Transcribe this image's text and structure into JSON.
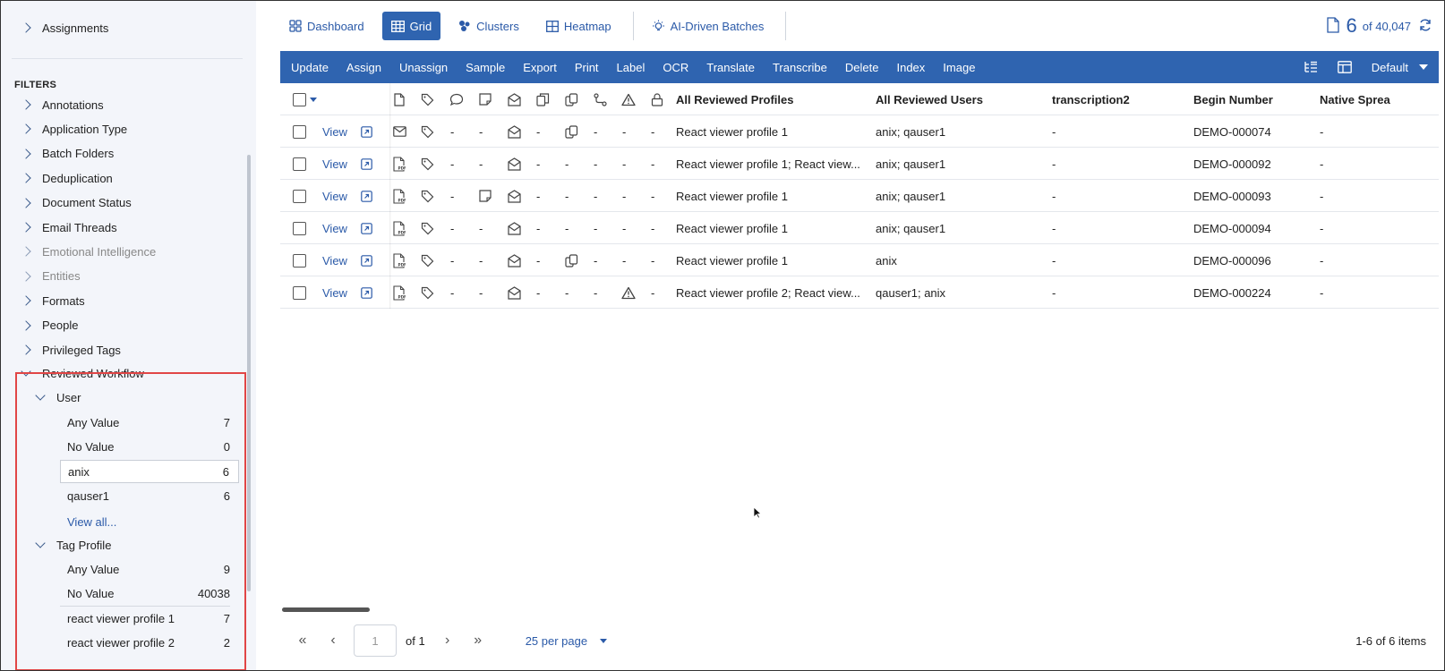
{
  "sidebar": {
    "assignments": "Assignments",
    "filters_title": "FILTERS",
    "filters": [
      {
        "label": "Annotations",
        "muted": false
      },
      {
        "label": "Application Type",
        "muted": false
      },
      {
        "label": "Batch Folders",
        "muted": false
      },
      {
        "label": "Deduplication",
        "muted": false
      },
      {
        "label": "Document Status",
        "muted": false
      },
      {
        "label": "Email Threads",
        "muted": false
      },
      {
        "label": "Emotional Intelligence",
        "muted": true
      },
      {
        "label": "Entities",
        "muted": true
      },
      {
        "label": "Formats",
        "muted": false
      },
      {
        "label": "People",
        "muted": false
      },
      {
        "label": "Privileged Tags",
        "muted": false
      }
    ],
    "reviewed_workflow": {
      "label": "Reviewed Workflow",
      "user": {
        "label": "User",
        "values": [
          {
            "label": "Any Value",
            "count": "7"
          },
          {
            "label": "No Value",
            "count": "0"
          },
          {
            "label": "anix",
            "count": "6"
          },
          {
            "label": "qauser1",
            "count": "6"
          }
        ],
        "view_all": "View all..."
      },
      "tag_profile": {
        "label": "Tag Profile",
        "values": [
          {
            "label": "Any Value",
            "count": "9"
          },
          {
            "label": "No Value",
            "count": "40038"
          },
          {
            "label": "react viewer profile 1",
            "count": "7"
          },
          {
            "label": "react viewer profile 2",
            "count": "2"
          }
        ]
      }
    }
  },
  "tabs": [
    {
      "label": "Dashboard",
      "icon": "dashboard-icon"
    },
    {
      "label": "Grid",
      "icon": "grid-icon"
    },
    {
      "label": "Clusters",
      "icon": "clusters-icon"
    },
    {
      "label": "Heatmap",
      "icon": "heatmap-icon"
    },
    {
      "label": "AI-Driven Batches",
      "icon": "lightbulb-icon"
    }
  ],
  "counter": {
    "count": "6",
    "total": "of 40,047"
  },
  "toolbar": {
    "buttons": [
      "Update",
      "Assign",
      "Unassign",
      "Sample",
      "Export",
      "Print",
      "Label",
      "OCR",
      "Translate",
      "Transcribe",
      "Delete",
      "Index",
      "Image"
    ],
    "layout": "Default"
  },
  "grid": {
    "columns": [
      "All Reviewed Profiles",
      "All Reviewed Users",
      "transcription2",
      "Begin Number",
      "Native Sprea"
    ],
    "view_label": "View",
    "dash": "-",
    "rows": [
      {
        "doc": "email",
        "note": false,
        "copy": true,
        "warn": false,
        "profiles": "React viewer profile 1",
        "users": "anix; qauser1",
        "transcription": "-",
        "begin": "DEMO-000074",
        "native": "-"
      },
      {
        "doc": "pdf",
        "note": false,
        "copy": false,
        "warn": false,
        "profiles": "React viewer profile 1; React view...",
        "users": "anix; qauser1",
        "transcription": "-",
        "begin": "DEMO-000092",
        "native": "-"
      },
      {
        "doc": "pdf",
        "note": true,
        "copy": false,
        "warn": false,
        "profiles": "React viewer profile 1",
        "users": "anix; qauser1",
        "transcription": "-",
        "begin": "DEMO-000093",
        "native": "-"
      },
      {
        "doc": "pdf",
        "note": false,
        "copy": false,
        "warn": false,
        "profiles": "React viewer profile 1",
        "users": "anix; qauser1",
        "transcription": "-",
        "begin": "DEMO-000094",
        "native": "-"
      },
      {
        "doc": "pdf",
        "note": false,
        "copy": true,
        "warn": false,
        "profiles": "React viewer profile 1",
        "users": "anix",
        "transcription": "-",
        "begin": "DEMO-000096",
        "native": "-"
      },
      {
        "doc": "pdf",
        "note": false,
        "copy": false,
        "warn": true,
        "profiles": "React viewer profile 2; React view...",
        "users": "qauser1; anix",
        "transcription": "-",
        "begin": "DEMO-000224",
        "native": "-"
      }
    ]
  },
  "pager": {
    "page": "1",
    "of": "of 1",
    "per_page": "25 per page",
    "items": "1-6 of 6 items"
  },
  "colors": {
    "primary": "#2f64b0",
    "link": "#2b5aa8",
    "sidebar_bg": "#f3f5fa",
    "highlight": "#e14646"
  }
}
